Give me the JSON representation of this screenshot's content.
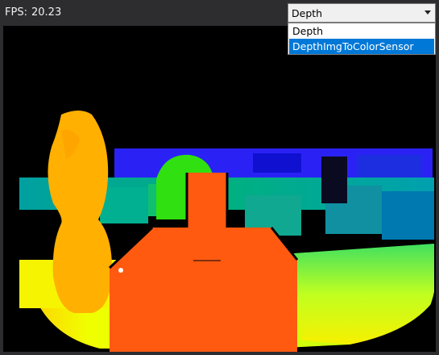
{
  "fps": {
    "label": "FPS:",
    "value": "20.23"
  },
  "stream_select": {
    "selected": "Depth",
    "options": [
      "Depth",
      "DepthImgToColorSensor"
    ],
    "highlighted_index": 1
  },
  "colors": {
    "window_bg": "#2d2d30",
    "highlight": "#0078d7",
    "depth_near": "#ff5a10",
    "depth_mid": "#ffb400",
    "depth_far": "#2020ff"
  },
  "viewport": {
    "content": "depth-colormap-image"
  }
}
